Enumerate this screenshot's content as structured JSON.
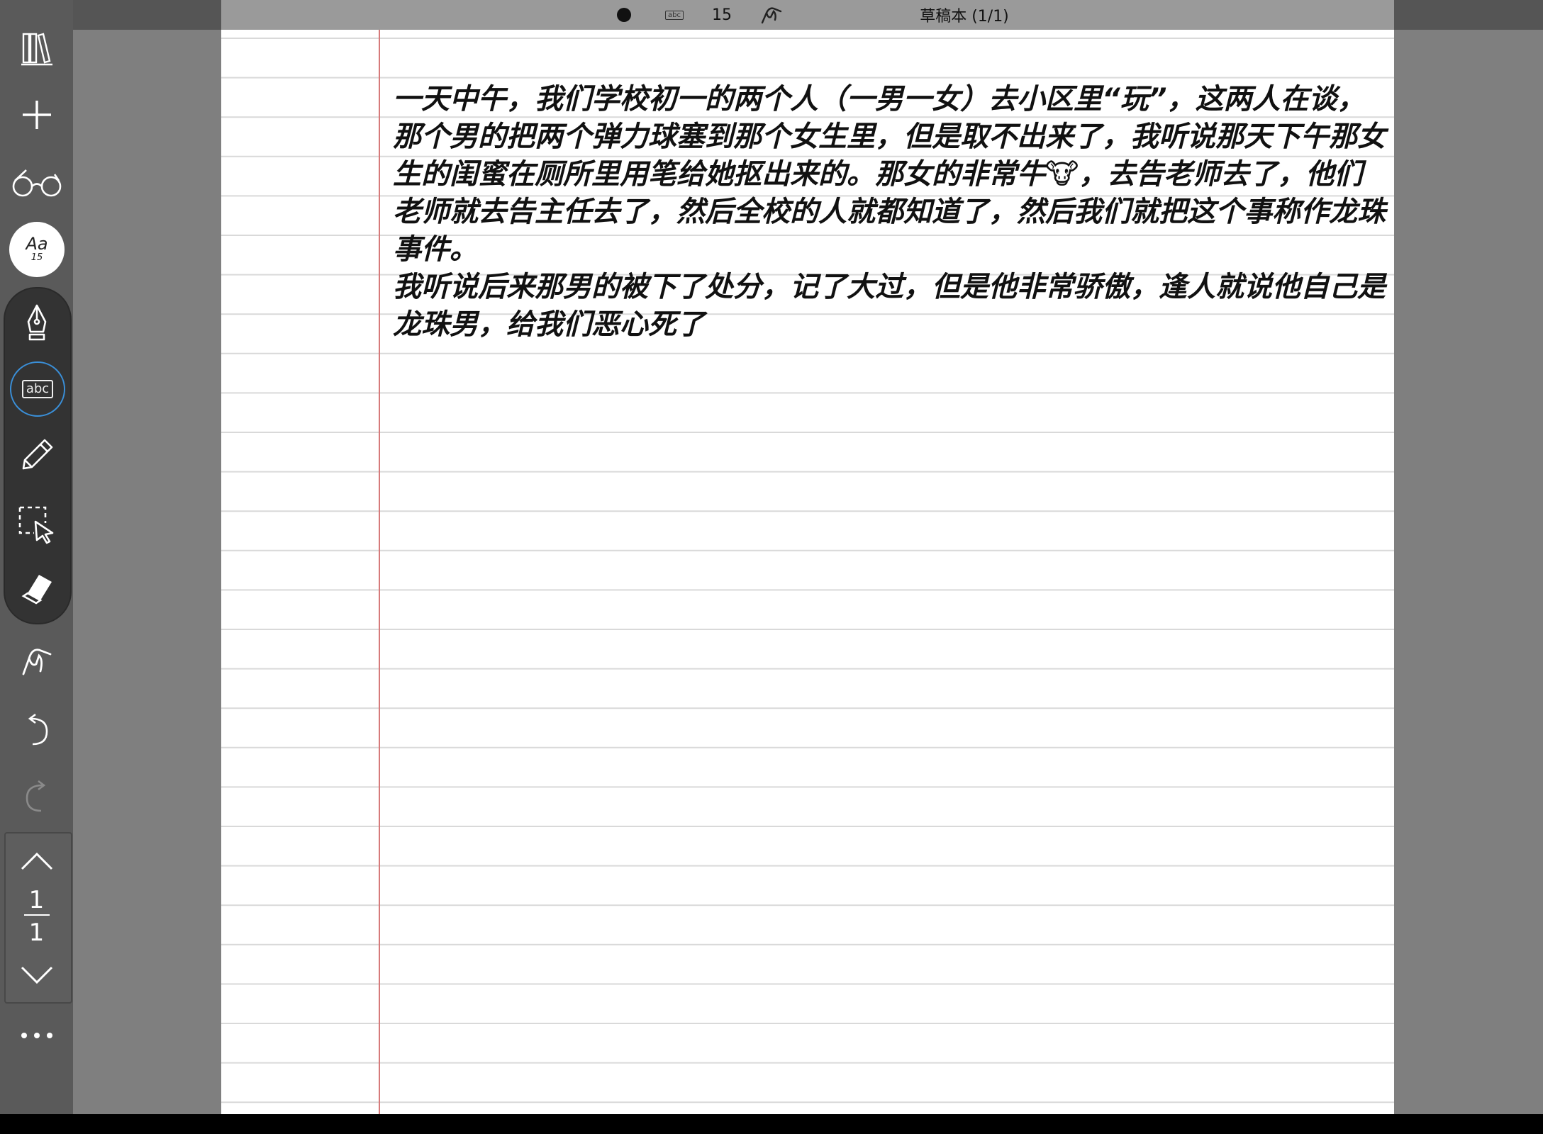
{
  "topbar": {
    "pen_color_label": "",
    "text_tool_icon": "abc-icon",
    "font_size": "15",
    "notebook_title": "草稿本 (1/1)"
  },
  "sidebar": {
    "icons": [
      "library-icon",
      "plus-icon",
      "glasses-icon",
      "font-icon",
      "fountain-pen-icon",
      "text-box-icon",
      "pencil-icon",
      "lasso-select-icon",
      "eraser-icon",
      "hand-draw-icon",
      "undo-icon",
      "redo-icon",
      "chevron-up-icon",
      "chevron-down-icon",
      "more-icon"
    ],
    "font_button": {
      "label": "Aa",
      "size": "15"
    },
    "text_tool_label": "abc",
    "page_current": "1",
    "page_total": "1"
  },
  "note": {
    "paragraph1": "一天中午，我们学校初一的两个人（一男一女）去小区里“玩”，这两人在谈，那个男的把两个弹力球塞到那个女生里，但是取不出来了，我听说那天下午那女生的闺蜜在厕所里用笔给她抠出来的。那女的非常牛🐮，去告老师去了，他们老师就去告主任去了，然后全校的人就都知道了，然后我们就把这个事称作龙珠事件。",
    "paragraph2": "我听说后来那男的被下了处分，记了大过，但是他非常骄傲，逢人就说他自己是龙珠男，给我们恶心死了"
  },
  "colors": {
    "accent": "#3a8fd8",
    "margin_line": "#d67a7a",
    "ruled_line": "#d9d9d9"
  }
}
